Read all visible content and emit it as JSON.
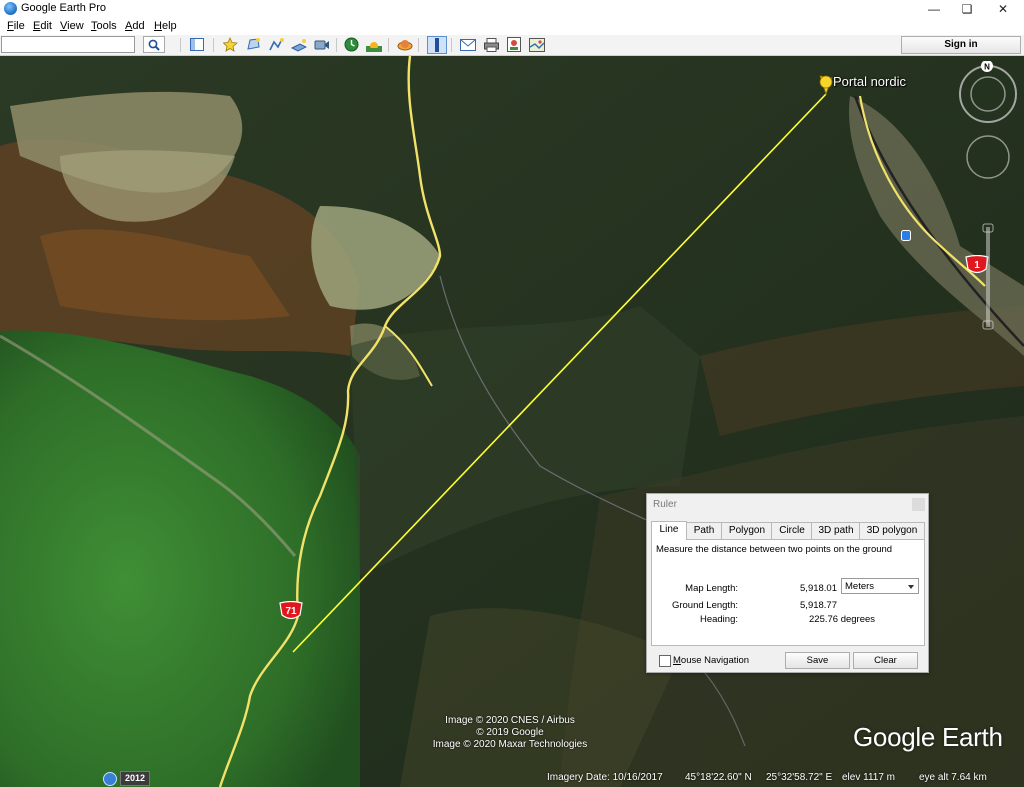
{
  "window": {
    "title": "Google Earth Pro",
    "controls": [
      "minimize-icon",
      "restore-icon",
      "close-icon"
    ]
  },
  "menu": [
    {
      "key": "F",
      "rest": "ile"
    },
    {
      "key": "E",
      "rest": "dit"
    },
    {
      "key": "V",
      "rest": "iew"
    },
    {
      "key": "T",
      "rest": "ools"
    },
    {
      "key": "A",
      "rest": "dd"
    },
    {
      "key": "H",
      "rest": "elp"
    }
  ],
  "toolbar": {
    "search_value": "",
    "icons": [
      "search-icon",
      "sidebar-toggle-icon",
      "add-placemark-icon",
      "add-polygon-icon",
      "add-path-icon",
      "add-image-overlay-icon",
      "record-tour-icon",
      "historical-imagery-icon",
      "sunlight-icon",
      "switch-planets-icon",
      "ruler-icon",
      "email-icon",
      "print-icon",
      "save-image-icon",
      "view-in-maps-icon"
    ],
    "signin_label": "Sign in"
  },
  "map": {
    "placemark_label": "Portal nordic",
    "road_shields": [
      "1",
      "71"
    ],
    "attribution": [
      "Image © 2020 CNES / Airbus",
      "© 2019 Google",
      "Image © 2020 Maxar Technologies"
    ],
    "brand": "Google Earth",
    "compass_label": "N",
    "year_badge": "2012",
    "status": {
      "imagery_date": "Imagery Date: 10/16/2017",
      "lat": "45°18'22.60\" N",
      "lon": "25°32'58.72\" E",
      "elev": "elev  1117 m",
      "eye_alt": "eye alt   7.64 km"
    },
    "colors": {
      "ruler_line": "#ffff33",
      "road": "#f2e26a"
    }
  },
  "ruler": {
    "title": "Ruler",
    "tabs": [
      "Line",
      "Path",
      "Polygon",
      "Circle",
      "3D path",
      "3D polygon"
    ],
    "active_tab": "Line",
    "description": "Measure the distance between two points on the ground",
    "map_length_label": "Map Length:",
    "map_length_value": "5,918.01",
    "unit": "Meters",
    "ground_length_label": "Ground Length:",
    "ground_length_value": "5,918.77",
    "heading_label": "Heading:",
    "heading_value": "225.76 degrees",
    "mouse_nav_label": "Mouse Navigation",
    "mouse_nav_checked": false,
    "save_label": "Save",
    "clear_label": "Clear"
  }
}
